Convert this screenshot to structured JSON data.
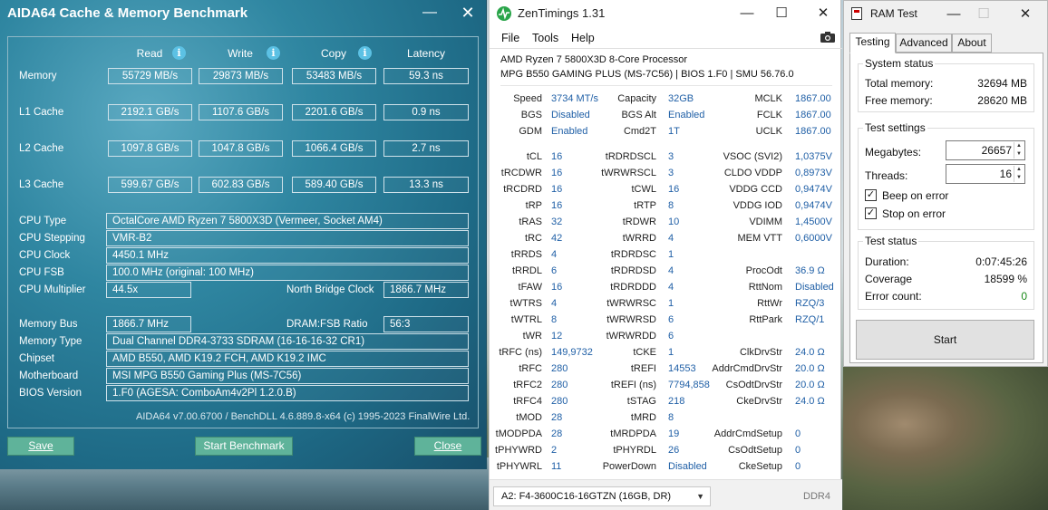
{
  "aida": {
    "title": "AIDA64 Cache & Memory Benchmark",
    "headers": {
      "read": "Read",
      "write": "Write",
      "copy": "Copy",
      "latency": "Latency"
    },
    "bench_rows": [
      {
        "label": "Memory",
        "read": "55729 MB/s",
        "write": "29873 MB/s",
        "copy": "53483 MB/s",
        "latency": "59.3 ns"
      },
      {
        "label": "L1 Cache",
        "read": "2192.1 GB/s",
        "write": "1107.6 GB/s",
        "copy": "2201.6 GB/s",
        "latency": "0.9 ns"
      },
      {
        "label": "L2 Cache",
        "read": "1097.8 GB/s",
        "write": "1047.8 GB/s",
        "copy": "1066.4 GB/s",
        "latency": "2.7 ns"
      },
      {
        "label": "L3 Cache",
        "read": "599.67 GB/s",
        "write": "602.83 GB/s",
        "copy": "589.40 GB/s",
        "latency": "13.3 ns"
      }
    ],
    "cpu_type_label": "CPU Type",
    "cpu_type": "OctalCore AMD Ryzen 7 5800X3D  (Vermeer, Socket AM4)",
    "cpu_stepping_label": "CPU Stepping",
    "cpu_stepping": "VMR-B2",
    "cpu_clock_label": "CPU Clock",
    "cpu_clock": "4450.1 MHz",
    "cpu_fsb_label": "CPU FSB",
    "cpu_fsb": "100.0 MHz  (original: 100 MHz)",
    "cpu_mult_label": "CPU Multiplier",
    "cpu_mult": "44.5x",
    "nb_clock_label": "North Bridge Clock",
    "nb_clock": "1866.7 MHz",
    "mem_bus_label": "Memory Bus",
    "mem_bus": "1866.7 MHz",
    "dram_fsb_label": "DRAM:FSB Ratio",
    "dram_fsb": "56:3",
    "mem_type_label": "Memory Type",
    "mem_type": "Dual Channel DDR4-3733 SDRAM  (16-16-16-32 CR1)",
    "chipset_label": "Chipset",
    "chipset": "AMD B550, AMD K19.2 FCH, AMD K19.2 IMC",
    "mobo_label": "Motherboard",
    "mobo": "MSI MPG B550 Gaming Plus (MS-7C56)",
    "bios_label": "BIOS Version",
    "bios": "1.F0  (AGESA: ComboAm4v2Pl 1.2.0.B)",
    "footer": "AIDA64 v7.00.6700 / BenchDLL 4.6.889.8-x64  (c) 1995-2023 FinalWire Ltd.",
    "save_label": "Save",
    "start_label": "Start Benchmark",
    "close_label": "Close"
  },
  "zen": {
    "title": "ZenTimings 1.31",
    "menu": [
      "File",
      "Tools",
      "Help"
    ],
    "cpu": "AMD Ryzen 7 5800X3D 8-Core Processor",
    "board": "MPG B550 GAMING PLUS (MS-7C56) | BIOS 1.F0 | SMU 56.76.0",
    "top": [
      {
        "l1": "Speed",
        "v1": "3734 MT/s",
        "l2": "Capacity",
        "v2": "32GB",
        "l3": "MCLK",
        "v3": "1867.00"
      },
      {
        "l1": "BGS",
        "v1": "Disabled",
        "l2": "BGS Alt",
        "v2": "Enabled",
        "l3": "FCLK",
        "v3": "1867.00"
      },
      {
        "l1": "GDM",
        "v1": "Enabled",
        "l2": "Cmd2T",
        "v2": "1T",
        "l3": "UCLK",
        "v3": "1867.00"
      }
    ],
    "rows": [
      {
        "l1": "tCL",
        "v1": "16",
        "l2": "tRDRDSCL",
        "v2": "3",
        "l3": "VSOC (SVI2)",
        "v3": "1,0375V"
      },
      {
        "l1": "tRCDWR",
        "v1": "16",
        "l2": "tWRWRSCL",
        "v2": "3",
        "l3": "CLDO VDDP",
        "v3": "0,8973V"
      },
      {
        "l1": "tRCDRD",
        "v1": "16",
        "l2": "tCWL",
        "v2": "16",
        "l3": "VDDG CCD",
        "v3": "0,9474V"
      },
      {
        "l1": "tRP",
        "v1": "16",
        "l2": "tRTP",
        "v2": "8",
        "l3": "VDDG IOD",
        "v3": "0,9474V"
      },
      {
        "l1": "tRAS",
        "v1": "32",
        "l2": "tRDWR",
        "v2": "10",
        "l3": "VDIMM",
        "v3": "1,4500V"
      },
      {
        "l1": "tRC",
        "v1": "42",
        "l2": "tWRRD",
        "v2": "4",
        "l3": "MEM VTT",
        "v3": "0,6000V"
      },
      {
        "l1": "tRRDS",
        "v1": "4",
        "l2": "tRDRDSC",
        "v2": "1",
        "l3": "",
        "v3": ""
      },
      {
        "l1": "tRRDL",
        "v1": "6",
        "l2": "tRDRDSD",
        "v2": "4",
        "l3": "ProcOdt",
        "v3": "36.9 Ω"
      },
      {
        "l1": "tFAW",
        "v1": "16",
        "l2": "tRDRDDD",
        "v2": "4",
        "l3": "RttNom",
        "v3": "Disabled"
      },
      {
        "l1": "tWTRS",
        "v1": "4",
        "l2": "tWRWRSC",
        "v2": "1",
        "l3": "RttWr",
        "v3": "RZQ/3"
      },
      {
        "l1": "tWTRL",
        "v1": "8",
        "l2": "tWRWRSD",
        "v2": "6",
        "l3": "RttPark",
        "v3": "RZQ/1"
      },
      {
        "l1": "tWR",
        "v1": "12",
        "l2": "tWRWRDD",
        "v2": "6",
        "l3": "",
        "v3": ""
      },
      {
        "l1": "tRFC (ns)",
        "v1": "149,9732",
        "l2": "tCKE",
        "v2": "1",
        "l3": "ClkDrvStr",
        "v3": "24.0 Ω"
      },
      {
        "l1": "tRFC",
        "v1": "280",
        "l2": "tREFI",
        "v2": "14553",
        "l3": "AddrCmdDrvStr",
        "v3": "20.0 Ω"
      },
      {
        "l1": "tRFC2",
        "v1": "280",
        "l2": "tREFI (ns)",
        "v2": "7794,858",
        "l3": "CsOdtDrvStr",
        "v3": "20.0 Ω"
      },
      {
        "l1": "tRFC4",
        "v1": "280",
        "l2": "tSTAG",
        "v2": "218",
        "l3": "CkeDrvStr",
        "v3": "24.0 Ω"
      },
      {
        "l1": "tMOD",
        "v1": "28",
        "l2": "tMRD",
        "v2": "8",
        "l3": "",
        "v3": ""
      },
      {
        "l1": "tMODPDA",
        "v1": "28",
        "l2": "tMRDPDA",
        "v2": "19",
        "l3": "AddrCmdSetup",
        "v3": "0"
      },
      {
        "l1": "tPHYWRD",
        "v1": "2",
        "l2": "tPHYRDL",
        "v2": "26",
        "l3": "CsOdtSetup",
        "v3": "0"
      },
      {
        "l1": "tPHYWRL",
        "v1": "11",
        "l2": "PowerDown",
        "v2": "Disabled",
        "l3": "CkeSetup",
        "v3": "0"
      }
    ],
    "module": "A2: F4-3600C16-16GTZN (16GB, DR)",
    "ddr": "DDR4",
    "colors": {
      "value": "#1f5fa6",
      "logo": "#2aa54a"
    }
  },
  "ram": {
    "title": "RAM Test",
    "tabs": [
      "Testing",
      "Advanced",
      "About"
    ],
    "system_status": "System status",
    "total_label": "Total memory:",
    "total": "32694 MB",
    "free_label": "Free memory:",
    "free": "28620 MB",
    "settings": "Test settings",
    "mb_label": "Megabytes:",
    "mb": "26657",
    "threads_label": "Threads:",
    "threads": "16",
    "beep_label": "Beep on error",
    "stop_label": "Stop on error",
    "status": "Test status",
    "duration_label": "Duration:",
    "duration": "0:07:45:26",
    "coverage_label": "Coverage",
    "coverage": "18599 %",
    "errors_label": "Error count:",
    "errors": "0",
    "start_label": "Start",
    "colors": {
      "errors": "#1a8a1a"
    }
  }
}
